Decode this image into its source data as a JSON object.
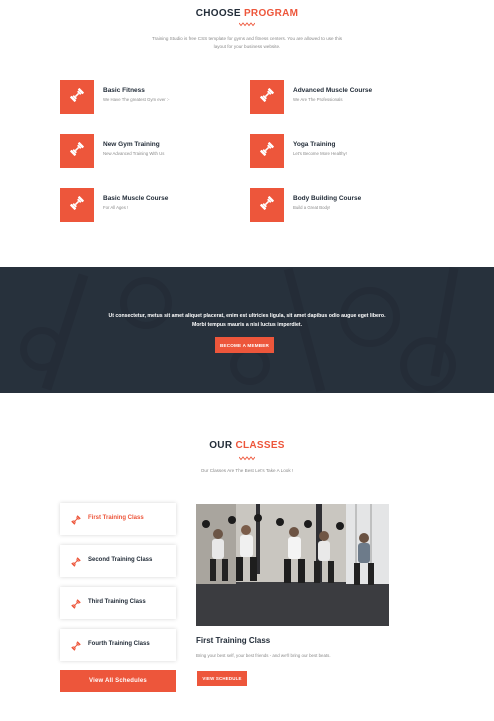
{
  "program": {
    "title_plain": "CHOOSE",
    "title_accent": "PROGRAM",
    "description": "Training Studio is free CSS template for gyms and fitness centers. You are allowed to use this layout for your business website.",
    "items": [
      {
        "title": "Basic Fitness",
        "desc": "We Have The greatest Gym ever :-",
        "icon": "dumbbell-icon"
      },
      {
        "title": "Advanced Muscle Course",
        "desc": "We Are The Professionals",
        "icon": "dumbbell-icon"
      },
      {
        "title": "New Gym Training",
        "desc": "New Advanced Training With Us",
        "icon": "dumbbell-icon"
      },
      {
        "title": "Yoga Training",
        "desc": "Let's Become More Healthy!",
        "icon": "dumbbell-icon"
      },
      {
        "title": "Basic Muscle Course",
        "desc": "For All Ages !",
        "icon": "dumbbell-icon"
      },
      {
        "title": "Body Building Course",
        "desc": "Build a Great Body!",
        "icon": "dumbbell-icon"
      }
    ]
  },
  "cta": {
    "line1": "Ut consectetur, metus sit amet aliquet placerat, enim est ultricies ligula, sit amet dapibus odio augue eget libero.",
    "line2": "Morbi tempus mauris a nisi luctus imperdiet.",
    "button": "BECOME A MEMBER"
  },
  "classes": {
    "title_plain": "OUR",
    "title_accent": "CLASSES",
    "description": "Our Classes Are The Best Let's Take A Look !",
    "tabs": [
      "First Training Class",
      "Second Training Class",
      "Third Training Class",
      "Fourth Training Class"
    ],
    "active_tab": 0,
    "view_all": "View All Schedules",
    "detail_title": "First Training Class",
    "detail_desc": "Bring your best self, your best friends - and we'll bring our best beats.",
    "detail_button": "VIEW SCHEDULE"
  },
  "colors": {
    "accent": "#ed563b",
    "dark": "#232d39",
    "muted": "#8a8a8a"
  }
}
